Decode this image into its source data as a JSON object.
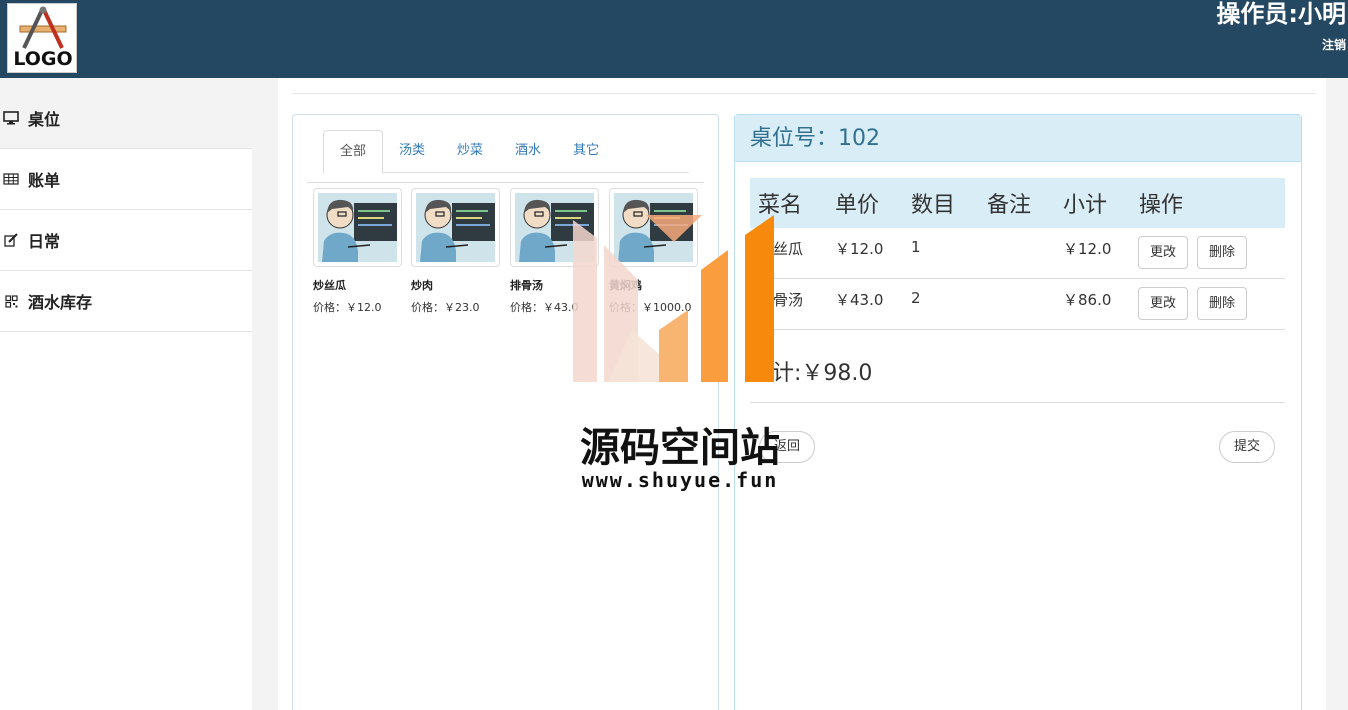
{
  "header": {
    "logo_text": "LOGO",
    "operator": "操作员:小明",
    "logout": "注销"
  },
  "sidebar": {
    "items": [
      {
        "label": "桌位",
        "icon": "monitor-icon"
      },
      {
        "label": "账单",
        "icon": "table-icon"
      },
      {
        "label": "日常",
        "icon": "edit-icon"
      },
      {
        "label": "酒水库存",
        "icon": "qrcode-icon"
      }
    ]
  },
  "menu": {
    "tabs": [
      "全部",
      "汤类",
      "炒菜",
      "酒水",
      "其它"
    ],
    "dishes": [
      {
        "name": "炒丝瓜",
        "price": "价格：￥12.0"
      },
      {
        "name": "炒肉",
        "price": "价格：￥23.0"
      },
      {
        "name": "排骨汤",
        "price": "价格：￥43.0"
      },
      {
        "name": "黄焖鸡",
        "price": "价格：￥1000.0"
      }
    ]
  },
  "order": {
    "table_title": "桌位号：102",
    "columns": [
      "菜名",
      "单价",
      "数目",
      "备注",
      "小计",
      "操作"
    ],
    "rows": [
      {
        "name": "炒丝瓜",
        "price": "￥12.0",
        "qty": "1",
        "note": "",
        "subtotal": "￥12.0",
        "edit": "更改",
        "delete": "删除"
      },
      {
        "name": "排骨汤",
        "price": "￥43.0",
        "qty": "2",
        "note": "",
        "subtotal": "￥86.0",
        "edit": "更改",
        "delete": "删除"
      }
    ],
    "total": "总计:￥98.0",
    "back_label": "返回",
    "submit_label": "提交"
  },
  "watermark": {
    "title": "源码空间站",
    "url": "www.shuyue.fun"
  },
  "colors": {
    "header_bg": "#244862",
    "panel_head_bg": "#d9edf7",
    "panel_head_text": "#31708f",
    "link": "#337ab7",
    "watermark_orange": "#f7890c"
  }
}
